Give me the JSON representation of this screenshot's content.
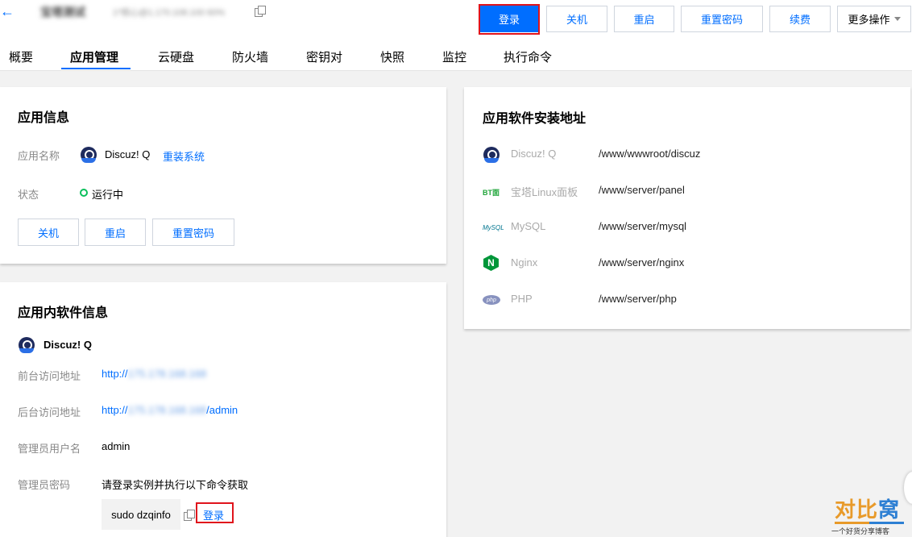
{
  "header": {
    "back_icon": "arrow-left-icon",
    "instance_name": "宝塔测试",
    "instance_id": "1*核心@1.170.108.100 60%",
    "buttons": {
      "login": "登录",
      "shutdown": "关机",
      "restart": "重启",
      "reset_password": "重置密码",
      "renew": "续费",
      "more": "更多操作"
    }
  },
  "tabs": [
    "概要",
    "应用管理",
    "云硬盘",
    "防火墙",
    "密钥对",
    "快照",
    "监控",
    "执行命令"
  ],
  "active_tab": "应用管理",
  "app_info": {
    "title": "应用信息",
    "name_label": "应用名称",
    "name_value": "Discuz! Q",
    "reinstall_link": "重装系统",
    "status_label": "状态",
    "status_value": "运行中",
    "buttons": {
      "shutdown": "关机",
      "restart": "重启",
      "reset_password": "重置密码"
    }
  },
  "software_info": {
    "title": "应用内软件信息",
    "app_name": "Discuz! Q",
    "frontend_label": "前台访问地址",
    "frontend_prefix": "http://",
    "frontend_ip": "175.178.168.168",
    "backend_label": "后台访问地址",
    "backend_prefix": "http://",
    "backend_ip": "175.178.168.168",
    "backend_suffix": "/admin",
    "admin_user_label": "管理员用户名",
    "admin_user_value": "admin",
    "admin_pass_label": "管理员密码",
    "admin_pass_hint": "请登录实例并执行以下命令获取",
    "command": "sudo dzqinfo",
    "login_link": "登录"
  },
  "install_paths": {
    "title": "应用软件安装地址",
    "items": [
      {
        "name": "Discuz! Q",
        "path": "/www/wwwroot/discuz",
        "icon": "discuz-icon"
      },
      {
        "name": "宝塔Linux面板",
        "path": "/www/server/panel",
        "icon": "bt-panel-icon"
      },
      {
        "name": "MySQL",
        "path": "/www/server/mysql",
        "icon": "mysql-icon"
      },
      {
        "name": "Nginx",
        "path": "/www/server/nginx",
        "icon": "nginx-icon"
      },
      {
        "name": "PHP",
        "path": "/www/server/php",
        "icon": "php-icon"
      }
    ]
  },
  "watermark": {
    "main_a": "对比",
    "main_b": "窝",
    "sub": "一个好货分享博客"
  },
  "colors": {
    "accent": "#006eff",
    "highlight": "#e0141c",
    "running": "#0abf5b"
  }
}
